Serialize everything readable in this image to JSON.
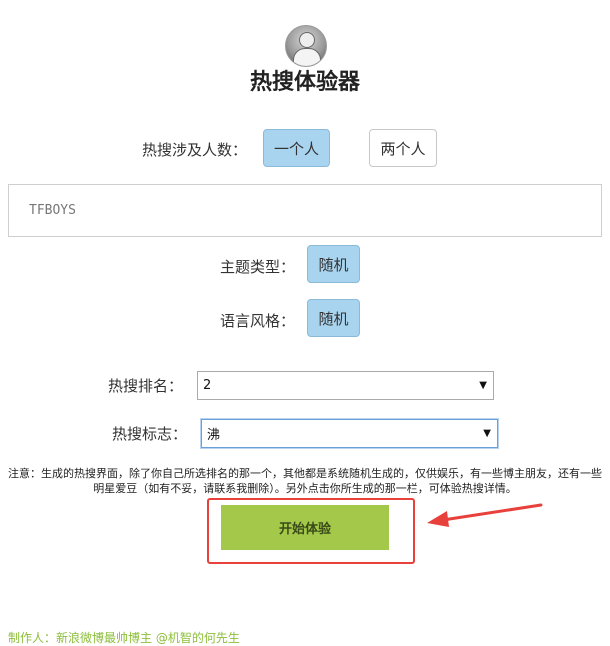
{
  "app": {
    "title": "热搜体验器"
  },
  "people": {
    "label": "热搜涉及人数：",
    "options": [
      "一个人",
      "两个人"
    ],
    "selected_index": 0
  },
  "name_input": {
    "value": "TFBOYS"
  },
  "theme": {
    "label": "主题类型：",
    "value": "随机"
  },
  "style": {
    "label": "语言风格：",
    "value": "随机"
  },
  "rank": {
    "label": "热搜排名：",
    "value": "2"
  },
  "badge": {
    "label": "热搜标志：",
    "value": "沸"
  },
  "notice": "注意：生成的热搜界面，除了你自己所选排名的那一个，其他都是系统随机生成的，仅供娱乐，有一些博主朋友，还有一些明星爱豆（如有不妥，请联系我删除）。另外点击你所生成的那一栏，可体验热搜详情。",
  "start_button": {
    "label": "开始体验"
  },
  "footer": "制作人：新浪微博最帅博主 @机智的何先生",
  "colors": {
    "accent_blue": "#a9d4ef",
    "start_green": "#a4c94a",
    "annotation_red": "#e8403a",
    "footer_green": "#8cbf3a"
  },
  "icons": {
    "avatar": "avatar-image",
    "dropdown": "chevron-down-icon",
    "annotation": "red-arrow-annotation"
  }
}
